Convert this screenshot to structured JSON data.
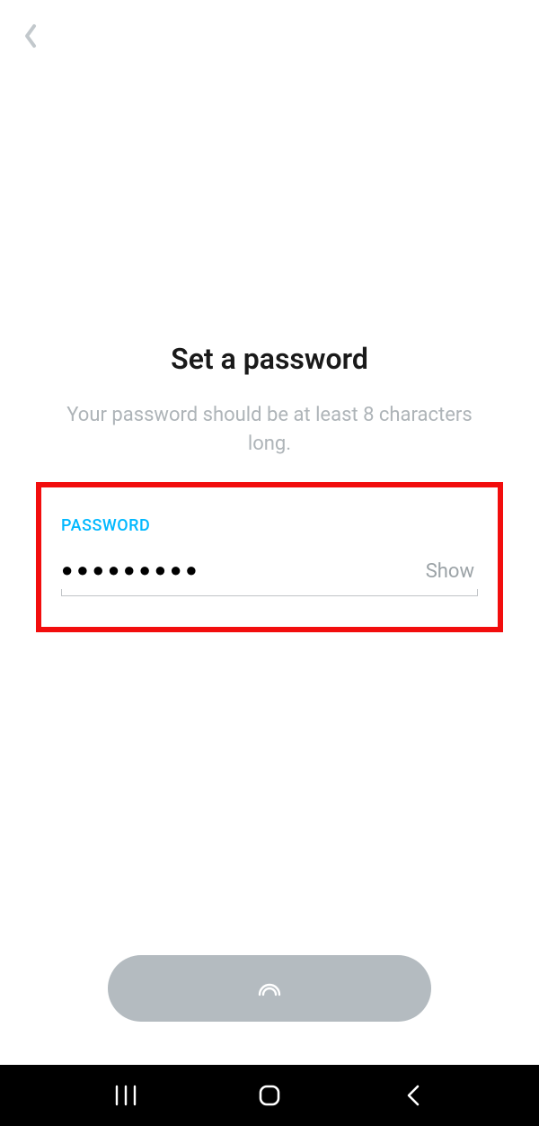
{
  "header": {
    "back_icon": "chevron-left"
  },
  "main": {
    "title": "Set a password",
    "subtitle": "Your password should be at least 8 characters long.",
    "password_field": {
      "label": "PASSWORD",
      "masked_value": "●●●●●●●●●",
      "show_toggle": "Show"
    }
  },
  "footer": {
    "continue_icon": "ghost-arc"
  },
  "navbar": {
    "recents": "recents-icon",
    "home": "home-icon",
    "back": "back-icon"
  }
}
